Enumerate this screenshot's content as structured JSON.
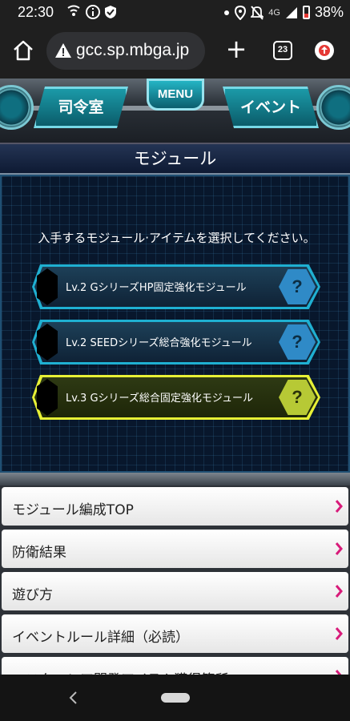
{
  "status_bar": {
    "time": "22:30",
    "network": "4G",
    "battery": "38%",
    "icons": [
      "wifi-calling-icon",
      "info-icon",
      "shield-icon",
      "dot-icon",
      "location-icon",
      "mute-icon",
      "signal-icon",
      "battery-icon"
    ]
  },
  "browser": {
    "url": "gcc.sp.mbga.jp",
    "tab_count": "23",
    "icons": [
      "home-icon",
      "warning-icon",
      "plus-icon",
      "tabs-icon",
      "update-icon"
    ]
  },
  "game_header": {
    "left_button": "司令室",
    "menu_button": "MENU",
    "right_button": "イベント"
  },
  "page_title": "モジュール",
  "instruction": "入手するモジュール·アイテムを選択してください。",
  "modules": [
    {
      "label": "Lv.2 GシリーズHP固定強化モジュール",
      "badge": "?",
      "color": "blue"
    },
    {
      "label": "Lv.2 SEEDシリーズ総合強化モジュール",
      "badge": "?",
      "color": "blue"
    },
    {
      "label": "Lv.3 Gシリーズ総合固定強化モジュール",
      "badge": "?",
      "color": "yellow"
    }
  ],
  "links": [
    "モジュール編成TOP",
    "防衛結果",
    "遊び方",
    "イベントルール詳細（必読）",
    "マスターレア開発アイテム獲得箇所"
  ],
  "colors": {
    "accent_cyan": "#1fb0d2",
    "accent_yellow": "#e7f136",
    "chevron_magenta": "#d81b7a"
  }
}
